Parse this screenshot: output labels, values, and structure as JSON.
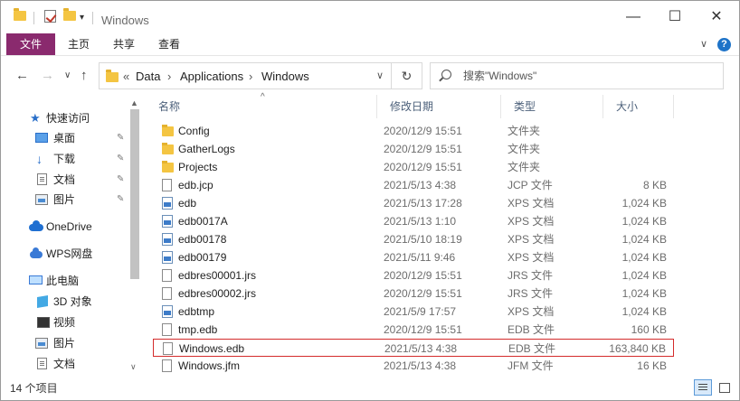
{
  "window": {
    "title": "Windows",
    "minimize_glyph": "—",
    "maximize_glyph": "☐",
    "close_glyph": "✕"
  },
  "ribbon": {
    "tabs": [
      {
        "label": "文件",
        "active": true
      },
      {
        "label": "主页",
        "active": false
      },
      {
        "label": "共享",
        "active": false
      },
      {
        "label": "查看",
        "active": false
      }
    ],
    "help_glyph": "?",
    "expand_glyph": "∨"
  },
  "nav": {
    "back_glyph": "←",
    "forward_glyph": "→",
    "history_glyph": "∨",
    "up_glyph": "↑",
    "breadcrumb_prefix": "«",
    "breadcrumb": [
      "Data",
      "Applications",
      "Windows"
    ],
    "separator": "›",
    "dropdown_glyph": "∨",
    "refresh_glyph": "↻",
    "search_placeholder": "搜索\"Windows\""
  },
  "sidebar": {
    "items": [
      {
        "label": "快速访问",
        "icon": "star-icon",
        "pinned": false
      },
      {
        "label": "桌面",
        "icon": "desktop-icon",
        "pinned": true
      },
      {
        "label": "下载",
        "icon": "download-icon",
        "pinned": true
      },
      {
        "label": "文档",
        "icon": "document-icon",
        "pinned": true
      },
      {
        "label": "图片",
        "icon": "picture-icon",
        "pinned": true
      },
      {
        "label": "OneDrive",
        "icon": "onedrive-icon",
        "pinned": false
      },
      {
        "label": "WPS网盘",
        "icon": "wps-cloud-icon",
        "pinned": false
      },
      {
        "label": "此电脑",
        "icon": "computer-icon",
        "pinned": false
      },
      {
        "label": "3D 对象",
        "icon": "3d-objects-icon",
        "pinned": false
      },
      {
        "label": "视频",
        "icon": "video-icon",
        "pinned": false
      },
      {
        "label": "图片",
        "icon": "picture-icon",
        "pinned": false
      },
      {
        "label": "文档",
        "icon": "document-icon",
        "pinned": false
      }
    ],
    "pin_glyph": "📌",
    "scroll_up_glyph": "▲",
    "scroll_down_glyph": "∨"
  },
  "columns": {
    "name": "名称",
    "date": "修改日期",
    "type": "类型",
    "size": "大小",
    "sort_glyph": "^"
  },
  "files": [
    {
      "name": "Config",
      "date": "2020/12/9 15:51",
      "type": "文件夹",
      "size": "",
      "icon": "folder-icon"
    },
    {
      "name": "GatherLogs",
      "date": "2020/12/9 15:51",
      "type": "文件夹",
      "size": "",
      "icon": "folder-icon"
    },
    {
      "name": "Projects",
      "date": "2020/12/9 15:51",
      "type": "文件夹",
      "size": "",
      "icon": "folder-icon"
    },
    {
      "name": "edb.jcp",
      "date": "2021/5/13 4:38",
      "type": "JCP 文件",
      "size": "8 KB",
      "icon": "file-icon"
    },
    {
      "name": "edb",
      "date": "2021/5/13 17:28",
      "type": "XPS 文档",
      "size": "1,024 KB",
      "icon": "xps-document-icon"
    },
    {
      "name": "edb0017A",
      "date": "2021/5/13 1:10",
      "type": "XPS 文档",
      "size": "1,024 KB",
      "icon": "xps-document-icon"
    },
    {
      "name": "edb00178",
      "date": "2021/5/10 18:19",
      "type": "XPS 文档",
      "size": "1,024 KB",
      "icon": "xps-document-icon"
    },
    {
      "name": "edb00179",
      "date": "2021/5/11 9:46",
      "type": "XPS 文档",
      "size": "1,024 KB",
      "icon": "xps-document-icon"
    },
    {
      "name": "edbres00001.jrs",
      "date": "2020/12/9 15:51",
      "type": "JRS 文件",
      "size": "1,024 KB",
      "icon": "file-icon"
    },
    {
      "name": "edbres00002.jrs",
      "date": "2020/12/9 15:51",
      "type": "JRS 文件",
      "size": "1,024 KB",
      "icon": "file-icon"
    },
    {
      "name": "edbtmp",
      "date": "2021/5/9 17:57",
      "type": "XPS 文档",
      "size": "1,024 KB",
      "icon": "xps-document-icon"
    },
    {
      "name": "tmp.edb",
      "date": "2020/12/9 15:51",
      "type": "EDB 文件",
      "size": "160 KB",
      "icon": "file-icon"
    },
    {
      "name": "Windows.edb",
      "date": "2021/5/13 4:38",
      "type": "EDB 文件",
      "size": "163,840 KB",
      "icon": "file-icon",
      "highlighted": true
    },
    {
      "name": "Windows.jfm",
      "date": "2021/5/13 4:38",
      "type": "JFM 文件",
      "size": "16 KB",
      "icon": "file-icon"
    }
  ],
  "status": {
    "item_count": "14 个项目"
  },
  "colors": {
    "ribbon_active": "#8a2a6e",
    "highlight_border": "#d42b2b",
    "accent": "#1e73c8"
  }
}
